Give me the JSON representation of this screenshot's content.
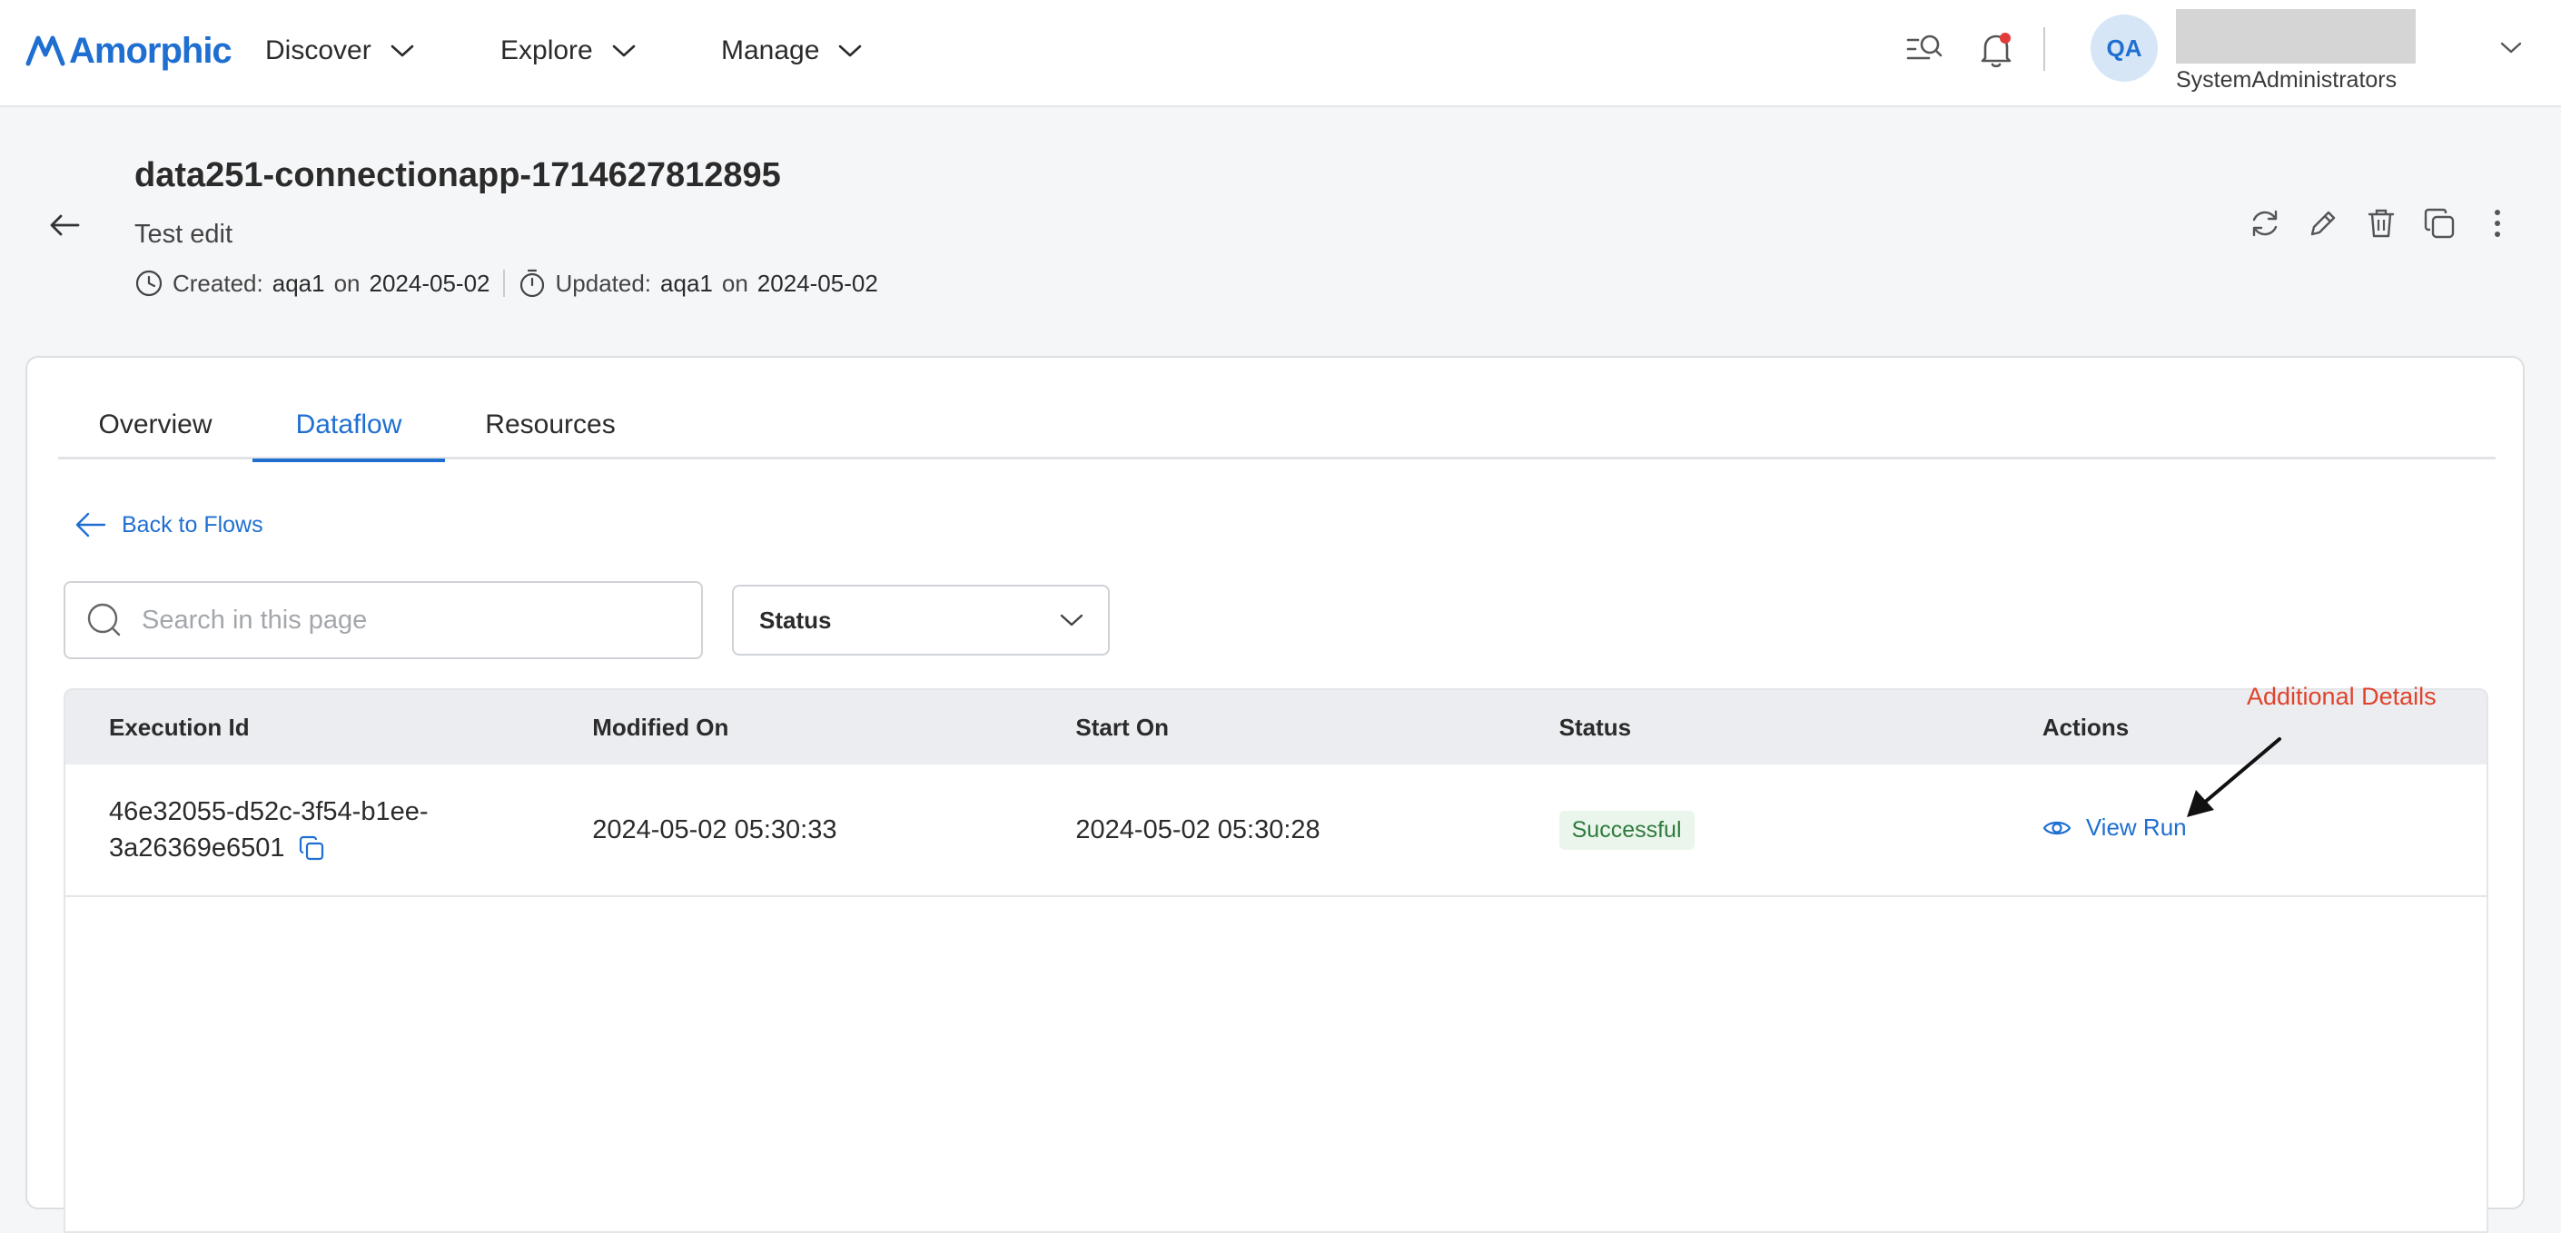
{
  "app": {
    "logo_text": "Amorphic",
    "colors": {
      "accent": "#1f6fd1",
      "success_bg": "#eaf6ec",
      "success_text": "#2f7a3c",
      "annotation": "#e0432b"
    }
  },
  "nav": {
    "menus": [
      {
        "label": "Discover"
      },
      {
        "label": "Explore"
      },
      {
        "label": "Manage"
      }
    ],
    "icons": [
      "search-list-icon",
      "bell-icon",
      "chevron-down-icon"
    ],
    "user": {
      "initials": "QA",
      "role": "SystemAdministrators"
    }
  },
  "header": {
    "title": "data251-connectionapp-1714627812895",
    "description": "Test edit",
    "created_label": "Created:",
    "created_by": "aqa1",
    "created_on_word": "on",
    "created_date": "2024-05-02",
    "updated_label": "Updated:",
    "updated_by": "aqa1",
    "updated_on_word": "on",
    "updated_date": "2024-05-02",
    "actions": [
      "refresh-icon",
      "edit-icon",
      "delete-icon",
      "clone-icon",
      "more-vertical-icon"
    ]
  },
  "tabs": [
    {
      "label": "Overview",
      "active": false
    },
    {
      "label": "Dataflow",
      "active": true
    },
    {
      "label": "Resources",
      "active": false
    }
  ],
  "dataflow": {
    "back_link": "Back to Flows",
    "search": {
      "placeholder": "Search in this page",
      "value": ""
    },
    "status_filter": {
      "selected": "Status"
    },
    "table": {
      "columns": [
        "Execution Id",
        "Modified On",
        "Start On",
        "Status",
        "Actions"
      ],
      "rows": [
        {
          "execution_id_line1": "46e32055-d52c-3f54-b1ee-",
          "execution_id_line2": "3a26369e6501",
          "modified_on": "2024-05-02 05:30:33",
          "start_on": "2024-05-02 05:30:28",
          "status": "Successful",
          "action_label": "View Run"
        }
      ]
    }
  },
  "annotation": {
    "text": "Additional Details"
  }
}
